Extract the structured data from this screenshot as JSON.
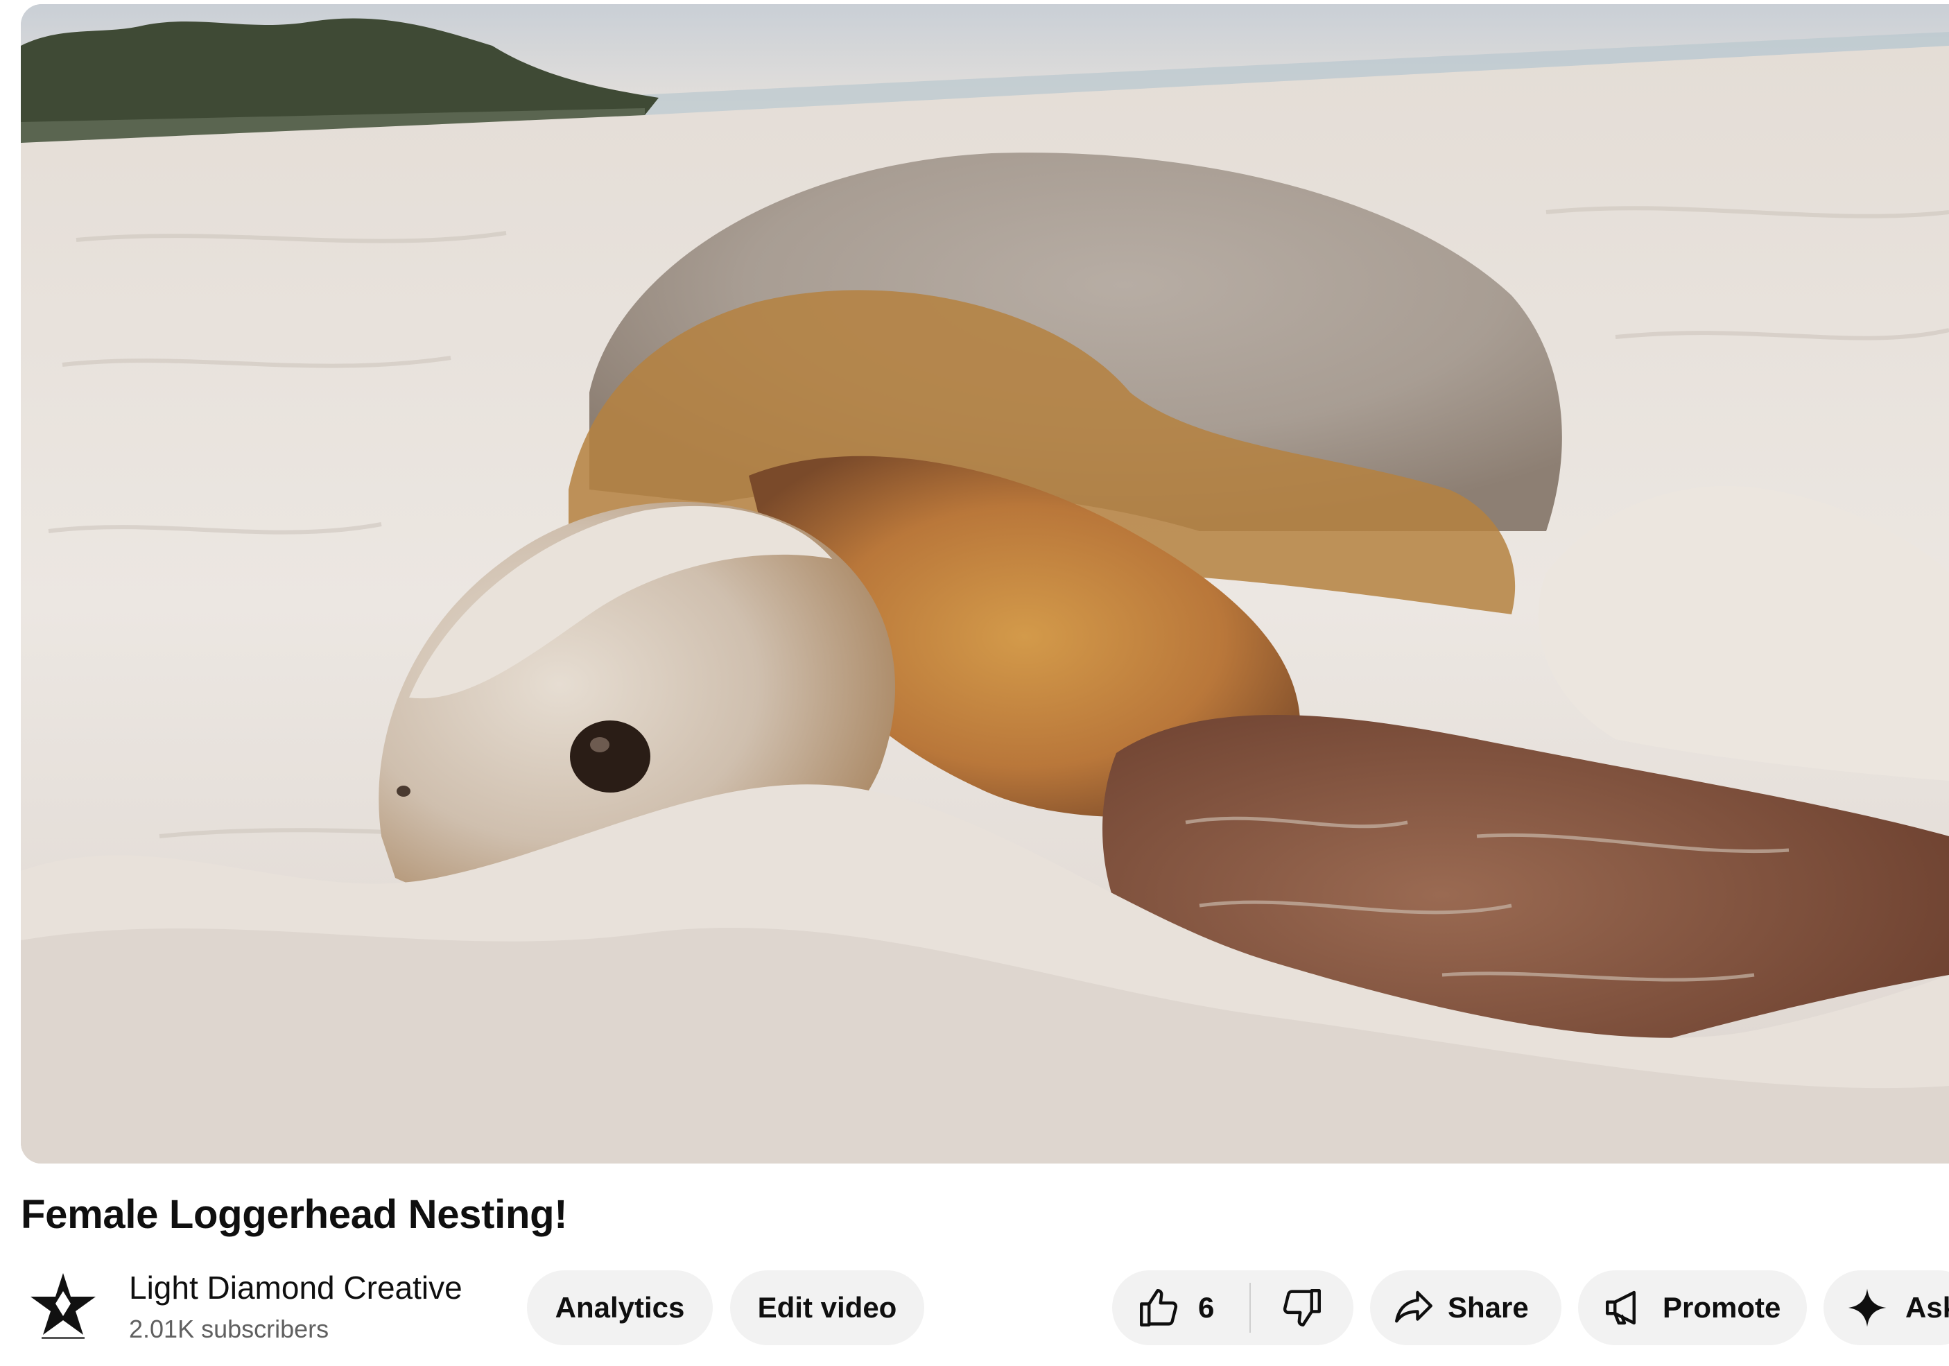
{
  "video": {
    "title": "Female Loggerhead Nesting!"
  },
  "channel": {
    "name": "Light Diamond Creative",
    "subscribers": "2.01K subscribers",
    "avatar_icon": "star-diamond-logo"
  },
  "actions": {
    "analytics_label": "Analytics",
    "edit_label": "Edit video",
    "like_count": "6",
    "share_label": "Share",
    "promote_label": "Promote",
    "ask_label": "Ask"
  },
  "icons": {
    "like": "thumb-up-icon",
    "dislike": "thumb-down-icon",
    "share": "share-arrow-icon",
    "promote": "megaphone-icon",
    "ask": "sparkle-icon"
  },
  "colors": {
    "pill_background": "#f2f2f2",
    "text_primary": "#0f0f0f",
    "text_secondary": "#606060"
  }
}
